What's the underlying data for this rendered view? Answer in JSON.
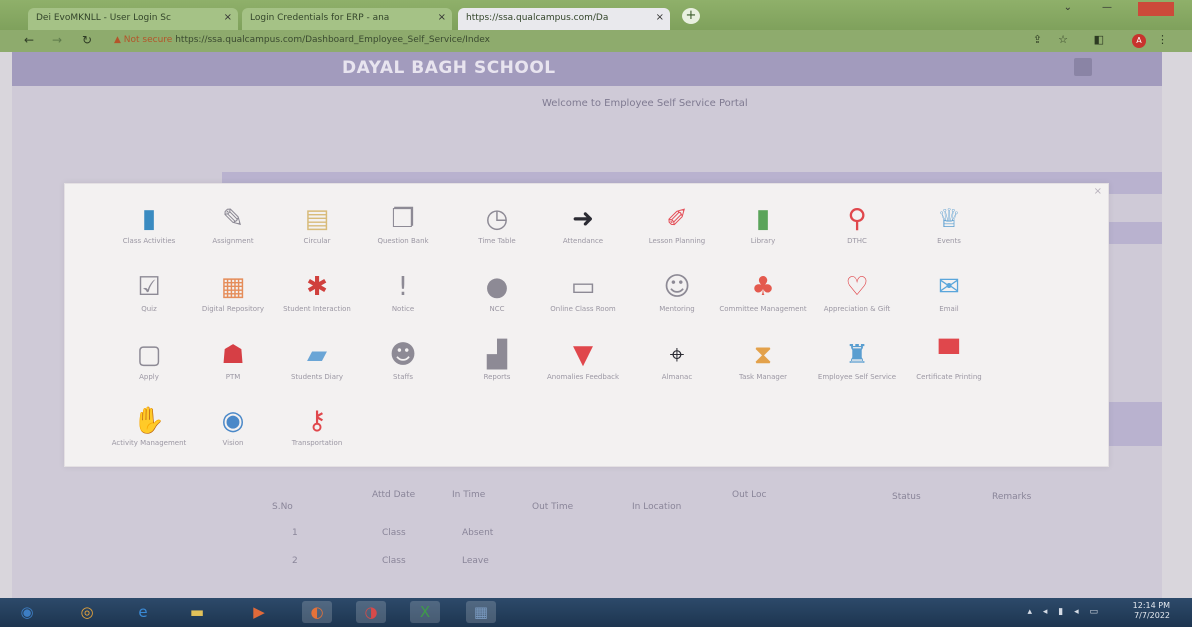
{
  "browser": {
    "tabs": [
      {
        "label": "Dei EvoMKNLL - User Login Sc",
        "active": false
      },
      {
        "label": "Login Credentials for ERP - ana",
        "active": false
      },
      {
        "label": "https://ssa.qualcampus.com/Da",
        "active": true
      }
    ],
    "new_tab_label": "+",
    "address_warning": "▲ Not secure",
    "address_url": "https://ssa.qualcampus.com/Dashboard_Employee_Self_Service/Index",
    "profile_badge": "A"
  },
  "page": {
    "school_name": "DAYAL BAGH SCHOOL",
    "welcome_text": "Welcome to Employee Self Service Portal",
    "background_table": {
      "row1": [
        "S.No",
        "Attd Date",
        "In Time",
        "Out Time",
        "In Location",
        "Out Loc",
        "Status",
        "Remarks"
      ],
      "row2": [
        "1",
        "Class",
        "Absent"
      ],
      "row3": [
        "2",
        "Class",
        "Leave"
      ]
    }
  },
  "modal": {
    "close_label": "×",
    "tiles": [
      {
        "label": "Class Activities",
        "icon": "book-icon",
        "glyph": "▮",
        "color": "#3a8bc1"
      },
      {
        "label": "Assignment",
        "icon": "edit-icon",
        "glyph": "✎",
        "color": "#8d8a95"
      },
      {
        "label": "Circular",
        "icon": "clipboard-icon",
        "glyph": "▤",
        "color": "#d8bb7a"
      },
      {
        "label": "Question Bank",
        "icon": "copy-icon",
        "glyph": "❐",
        "color": "#8d8a95"
      },
      {
        "label": "Time Table",
        "icon": "clock-icon",
        "glyph": "◷",
        "color": "#8d8a95"
      },
      {
        "label": "Attendance",
        "icon": "sign-in-icon",
        "glyph": "➜",
        "color": "#2b2b33"
      },
      {
        "label": "Lesson Planning",
        "icon": "pin-icon",
        "glyph": "✐",
        "color": "#e4515a"
      },
      {
        "label": "Library",
        "icon": "library-book-icon",
        "glyph": "▮",
        "color": "#5aa45a"
      },
      {
        "label": "DTHC",
        "icon": "magnifier-icon",
        "glyph": "⚲",
        "color": "#e0474c"
      },
      {
        "label": "Events",
        "icon": "trophy-icon",
        "glyph": "♕",
        "color": "#5a9ed0"
      },
      {
        "label": "Quiz",
        "icon": "checkbox-icon",
        "glyph": "☑",
        "color": "#8d8a95"
      },
      {
        "label": "Digital Repository",
        "icon": "document-icon",
        "glyph": "▦",
        "color": "#e58d5a"
      },
      {
        "label": "Student Interaction",
        "icon": "person-icon",
        "glyph": "✱",
        "color": "#d0403d"
      },
      {
        "label": "Notice",
        "icon": "alert-icon",
        "glyph": "!",
        "color": "#8d8a95"
      },
      {
        "label": "NCC",
        "icon": "globe-icon",
        "glyph": "●",
        "color": "#8d8a95"
      },
      {
        "label": "Online Class Room",
        "icon": "keyboard-icon",
        "glyph": "▭",
        "color": "#8d8a95"
      },
      {
        "label": "Mentoring",
        "icon": "users-icon",
        "glyph": "☺",
        "color": "#8d8a95"
      },
      {
        "label": "Committee Management",
        "icon": "group-icon",
        "glyph": "♣",
        "color": "#e45a4e"
      },
      {
        "label": "Appreciation & Gift",
        "icon": "lightbulb-icon",
        "glyph": "♡",
        "color": "#e0474c"
      },
      {
        "label": "Email",
        "icon": "envelope-icon",
        "glyph": "✉",
        "color": "#5aa6db"
      },
      {
        "label": "Apply",
        "icon": "tablet-icon",
        "glyph": "▢",
        "color": "#8d8a95"
      },
      {
        "label": "PTM",
        "icon": "user-plus-icon",
        "glyph": "☗",
        "color": "#d63f45"
      },
      {
        "label": "Students Diary",
        "icon": "chat-icon",
        "glyph": "▰",
        "color": "#6aa5d6"
      },
      {
        "label": "Staffs",
        "icon": "staff-icon",
        "glyph": "☻",
        "color": "#8d8a95"
      },
      {
        "label": "Reports",
        "icon": "bar-chart-icon",
        "glyph": "▟",
        "color": "#8d8a95"
      },
      {
        "label": "Anomalies Feedback",
        "icon": "funnel-icon",
        "glyph": "▼",
        "color": "#e0474c"
      },
      {
        "label": "Almanac",
        "icon": "crosshair-icon",
        "glyph": "⌖",
        "color": "#2b2b33"
      },
      {
        "label": "Task Manager",
        "icon": "hourglass-icon",
        "glyph": "⧗",
        "color": "#e3a14a"
      },
      {
        "label": "Employee Self Service",
        "icon": "employee-icon",
        "glyph": "♜",
        "color": "#5a9ed0"
      },
      {
        "label": "Certificate Printing",
        "icon": "printer-icon",
        "glyph": "▀",
        "color": "#e0474c"
      },
      {
        "label": "Activity Management",
        "icon": "thumbs-up-icon",
        "glyph": "✋",
        "color": "#4a88c8"
      },
      {
        "label": "Vision",
        "icon": "eye-icon",
        "glyph": "◉",
        "color": "#4a88c8"
      },
      {
        "label": "Transportation",
        "icon": "keys-icon",
        "glyph": "⚷",
        "color": "#e0474c"
      }
    ]
  },
  "taskbar": {
    "apps": [
      {
        "icon": "start-icon",
        "glyph": "◉",
        "color": "#3d7ec4"
      },
      {
        "icon": "chrome-icon",
        "glyph": "◎",
        "color": "#e7a43a"
      },
      {
        "icon": "ie-icon",
        "glyph": "e",
        "color": "#3a8ad6"
      },
      {
        "icon": "folder-icon",
        "glyph": "▬",
        "color": "#e2c25a"
      },
      {
        "icon": "media-icon",
        "glyph": "▶",
        "color": "#e06a3a"
      },
      {
        "icon": "firefox-icon",
        "glyph": "◐",
        "color": "#e4723a"
      },
      {
        "icon": "opera-icon",
        "glyph": "◑",
        "color": "#d64a4a"
      },
      {
        "icon": "excel-icon",
        "glyph": "X",
        "color": "#3f9a4a"
      },
      {
        "icon": "window-icon",
        "glyph": "▦",
        "color": "#7a9ac0"
      }
    ],
    "tray_text": "▴ ◂ ▮ ◂ ▭",
    "clock_time": "12:14 PM",
    "clock_date": "7/7/2022"
  }
}
